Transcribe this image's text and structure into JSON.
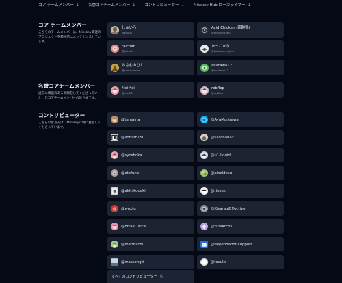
{
  "nav": [
    {
      "label": "コア チームメンバー",
      "arrow": "↓"
    },
    {
      "label": "名誉コアチームメンバー",
      "arrow": "↓"
    },
    {
      "label": "コントリビューター",
      "arrow": "↓"
    },
    {
      "label": "Misskey Hub ローカライザー",
      "arrow": "↓"
    }
  ],
  "core": {
    "title": "コア チームメンバー",
    "description": "こちらのチームメンバーは、Misskey関連のプロジェクトを積極的にメンテナンスしています。",
    "members": [
      {
        "name": "しゅいろ",
        "handle": "@syuilo",
        "avatar": "avatar-syuilo",
        "color": "#c9b8a6"
      },
      {
        "name": "Acid Chicken (硫酸鶏)",
        "handle": "@acid-chicken",
        "avatar": "avatar-acid-chicken",
        "color": "#2a2f38"
      },
      {
        "name": "taichan",
        "handle": "@tai-cha",
        "avatar": "avatar-taichan",
        "color": "#e88a8a"
      },
      {
        "name": "かっこかり",
        "handle": "@kakkokari-gtyih",
        "avatar": "avatar-kakkokari",
        "color": "#e9e9ea"
      },
      {
        "name": "おさむのひと",
        "handle": "@samunohito",
        "avatar": "avatar-samunohito",
        "color": "#c7a24a"
      },
      {
        "name": "anatawa12",
        "handle": "@anatawa12",
        "avatar": "avatar-anatawa12",
        "color": "#55b85a"
      }
    ]
  },
  "emeritus": {
    "title": "名誉コアチームメンバー",
    "description": "過去に価値のある貢献をしてくださっていた、元コアチームメンバーの皆さまです。",
    "members": [
      {
        "name": "MeiMei",
        "handle": "@mei23",
        "avatar": "avatar-meimei",
        "color": "#e7a0a6"
      },
      {
        "name": "robflop",
        "handle": "@robflop",
        "avatar": "avatar-robflop",
        "color": "#d8b8c8"
      }
    ]
  },
  "contributors": {
    "title": "コントリビューター",
    "description": "こちらの皆さんは、Misskeyに特に貢献してくださっています。",
    "list": [
      {
        "name": "@tamaina",
        "avatar": "avatar-tamaina",
        "color": "#b88a6a"
      },
      {
        "name": "@AyaMorisawa",
        "avatar": "avatar-ayamorisawa",
        "color": "#1ea6e6"
      },
      {
        "name": "@lioharn150",
        "avatar": "avatar-lioharn150",
        "color": "#ffffff"
      },
      {
        "name": "@saschanaz",
        "avatar": "avatar-saschanaz",
        "color": "#d8d0c4"
      },
      {
        "name": "@syoshoka",
        "avatar": "avatar-syoshoka",
        "color": "#e6a3a8"
      },
      {
        "name": "@u1-liquid",
        "avatar": "avatar-u1-liquid",
        "color": "#cfd6de"
      },
      {
        "name": "@otofune",
        "avatar": "avatar-otofune",
        "color": "#a89a94"
      },
      {
        "name": "@pixeldesu",
        "avatar": "avatar-pixeldesu",
        "color": "#9ec47a"
      },
      {
        "name": "@akihikodaki",
        "avatar": "avatar-akihikodaki",
        "color": "#cfcfcf"
      },
      {
        "name": "@rinsuki",
        "avatar": "avatar-rinsuki",
        "color": "#efefef"
      },
      {
        "name": "@woxtu",
        "avatar": "avatar-woxtu",
        "color": "#c83a3a"
      },
      {
        "name": "@KisaragiEffective",
        "avatar": "avatar-kisaragieffective",
        "color": "#8a8d94"
      },
      {
        "name": "@EbiseLutica",
        "avatar": "avatar-ebiselutica",
        "color": "#f08aa8"
      },
      {
        "name": "@FineArchs",
        "avatar": "avatar-finearchs",
        "color": "#b9a3e0"
      },
      {
        "name": "@marihachi",
        "avatar": "avatar-marihachi",
        "color": "#9fc98e"
      },
      {
        "name": "@dependabot-support",
        "avatar": "avatar-dependabot",
        "color": "#1f6feb"
      },
      {
        "name": "@massongit",
        "avatar": "avatar-massongit",
        "color": "#8aa3b8"
      },
      {
        "name": "@tosuke",
        "avatar": "avatar-tosuke",
        "color": "#e8e8e8"
      }
    ],
    "all_link": "すべてのコントリビューター",
    "all_link_icon": "external-link-icon"
  }
}
